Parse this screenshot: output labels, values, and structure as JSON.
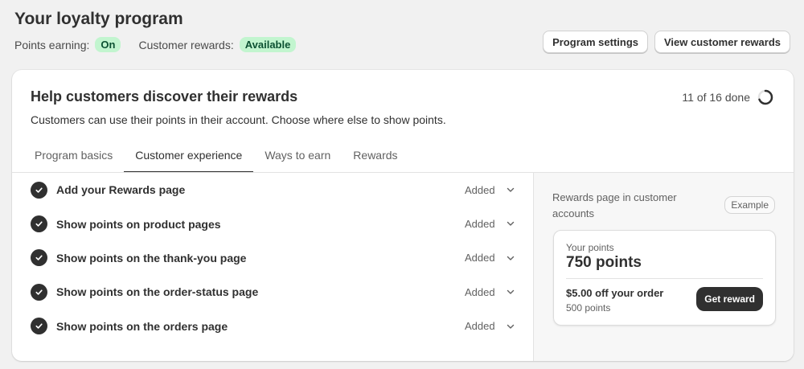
{
  "header": {
    "title": "Your loyalty program",
    "points_earning_label": "Points earning:",
    "points_earning_status": "On",
    "customer_rewards_label": "Customer rewards:",
    "customer_rewards_status": "Available",
    "actions": {
      "program_settings": "Program settings",
      "view_customer_rewards": "View customer rewards"
    }
  },
  "card": {
    "title": "Help customers discover their rewards",
    "subtitle": "Customers can use their points in their account. Choose where else to show points.",
    "progress_text": "11 of 16 done",
    "progress_done": 11,
    "progress_total": 16,
    "tabs": [
      {
        "label": "Program basics",
        "active": false
      },
      {
        "label": "Customer experience",
        "active": true
      },
      {
        "label": "Ways to earn",
        "active": false
      },
      {
        "label": "Rewards",
        "active": false
      }
    ],
    "tasks": [
      {
        "label": "Add your Rewards page",
        "status": "Added"
      },
      {
        "label": "Show points on product pages",
        "status": "Added"
      },
      {
        "label": "Show points on the thank-you page",
        "status": "Added"
      },
      {
        "label": "Show points on the order-status page",
        "status": "Added"
      },
      {
        "label": "Show points on the orders page",
        "status": "Added"
      }
    ]
  },
  "side_panel": {
    "title": "Rewards page in customer accounts",
    "example_label": "Example",
    "preview": {
      "your_points_label": "Your points",
      "points_value": "750 points",
      "reward_title": "$5.00 off your order",
      "reward_cost": "500 points",
      "get_reward_label": "Get reward"
    }
  },
  "colors": {
    "background": "#f1f1f1",
    "badge_bg": "#c2f5cf",
    "badge_text": "#0c5132",
    "primary_dark": "#303030"
  }
}
